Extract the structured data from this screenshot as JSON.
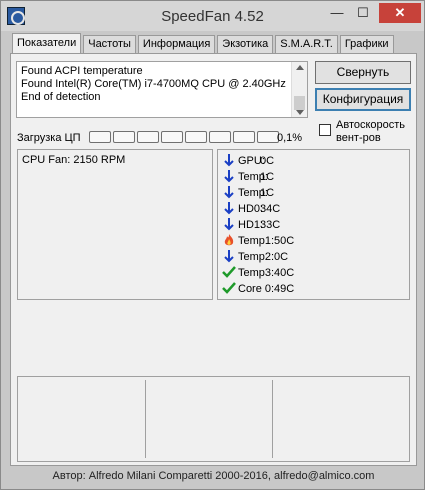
{
  "window": {
    "title": "SpeedFan 4.52"
  },
  "titlebar": {
    "minimize": "—",
    "maximize": "☐",
    "close": "✕"
  },
  "tabs": [
    {
      "label": "Показатели",
      "active": true
    },
    {
      "label": "Частоты",
      "active": false
    },
    {
      "label": "Информация",
      "active": false
    },
    {
      "label": "Экзотика",
      "active": false
    },
    {
      "label": "S.M.A.R.T.",
      "active": false
    },
    {
      "label": "Графики",
      "active": false
    }
  ],
  "log": {
    "lines": [
      "Found ACPI temperature",
      "Found Intel(R) Core(TM) i7-4700MQ CPU @ 2.40GHz",
      "End of detection"
    ]
  },
  "buttons": {
    "minimize": "Свернуть",
    "config": "Конфигурация"
  },
  "autospeed": {
    "label": "Автоскорость вент-ров",
    "checked": false
  },
  "cpu": {
    "label": "Загрузка ЦП",
    "percent": "0,1%",
    "segments": 8,
    "load_fraction": 0.001
  },
  "fans": [
    {
      "text": "CPU Fan: 2150 RPM"
    }
  ],
  "temps": [
    {
      "name": "GPU:",
      "value": "0C",
      "icon": "arrow-down-icon"
    },
    {
      "name": "Temp:",
      "value": "1C",
      "icon": "arrow-down-icon"
    },
    {
      "name": "Temp:",
      "value": "1C",
      "icon": "arrow-down-icon"
    },
    {
      "name": "HD0:",
      "value": "34C",
      "icon": "arrow-down-icon"
    },
    {
      "name": "HD1:",
      "value": "33C",
      "icon": "arrow-down-icon"
    },
    {
      "name": "Temp1:",
      "value": "50C",
      "icon": "flame-icon"
    },
    {
      "name": "Temp2:",
      "value": "0C",
      "icon": "arrow-down-icon"
    },
    {
      "name": "Temp3:",
      "value": "40C",
      "icon": "checkmark-icon"
    },
    {
      "name": "Core 0:",
      "value": "49C",
      "icon": "checkmark-icon"
    }
  ],
  "status": {
    "text": "Автор: Alfredo Milani Comparetti 2000-2016, alfredo@almico.com"
  },
  "colors": {
    "arrow": "#1a3fc4",
    "flame": "#e8502a",
    "check": "#1e9a2a"
  }
}
